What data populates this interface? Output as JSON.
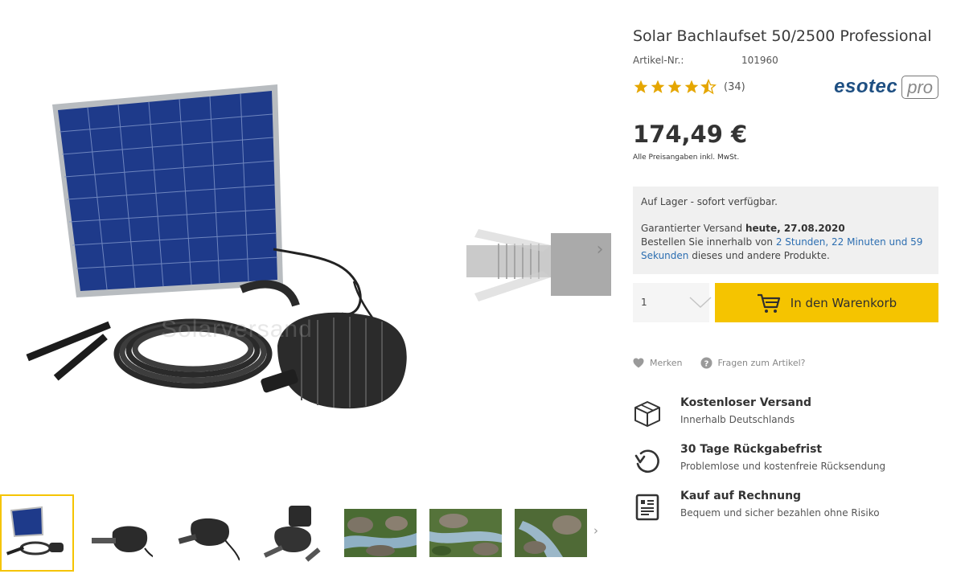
{
  "product": {
    "title": "Solar Bachlaufset 50/2500 Professional",
    "sku_label": "Artikel-Nr.:",
    "sku_value": "101960",
    "rating": 4.5,
    "rating_max": 5,
    "review_count": "(34)",
    "brand_main": "esotec",
    "brand_pro": "pro",
    "price": "174,49 €",
    "price_note": "Alle Preisangaben inkl. MwSt."
  },
  "gallery": {
    "watermark": "Solarversand",
    "next_arrow": "›",
    "thumb_next": "›",
    "thumbnails": [
      "solar-set",
      "pump-side",
      "pump-cable",
      "pump-parts",
      "garden-stream-1",
      "garden-stream-2",
      "garden-stream-3"
    ]
  },
  "stock": {
    "availability": "Auf Lager - sofort verfügbar.",
    "shipping_prefix": "Garantierter Versand ",
    "shipping_date": "heute, 27.08.2020",
    "order_prefix": "Bestellen Sie innerhalb von ",
    "countdown_line1": "2 Stunden, 22 Minuten und 59",
    "countdown_line2": "Sekunden",
    "order_suffix": " dieses und andere Produkte."
  },
  "purchase": {
    "quantity": "1",
    "cart_label": "In den Warenkorb"
  },
  "actions": {
    "wishlist": "Merken",
    "question": "Fragen zum Artikel?"
  },
  "features": [
    {
      "icon": "box-icon",
      "title": "Kostenloser Versand",
      "subtitle": "Innerhalb Deutschlands"
    },
    {
      "icon": "return-icon",
      "title": "30 Tage Rückgabefrist",
      "subtitle": "Problemlose und kostenfreie Rücksendung"
    },
    {
      "icon": "invoice-icon",
      "title": "Kauf auf Rechnung",
      "subtitle": "Bequem und sicher bezahlen ohne Risiko"
    }
  ],
  "colors": {
    "accent": "#f5c400",
    "brand": "#1e4f82",
    "link": "#2c6eb1",
    "star": "#e5a600"
  }
}
